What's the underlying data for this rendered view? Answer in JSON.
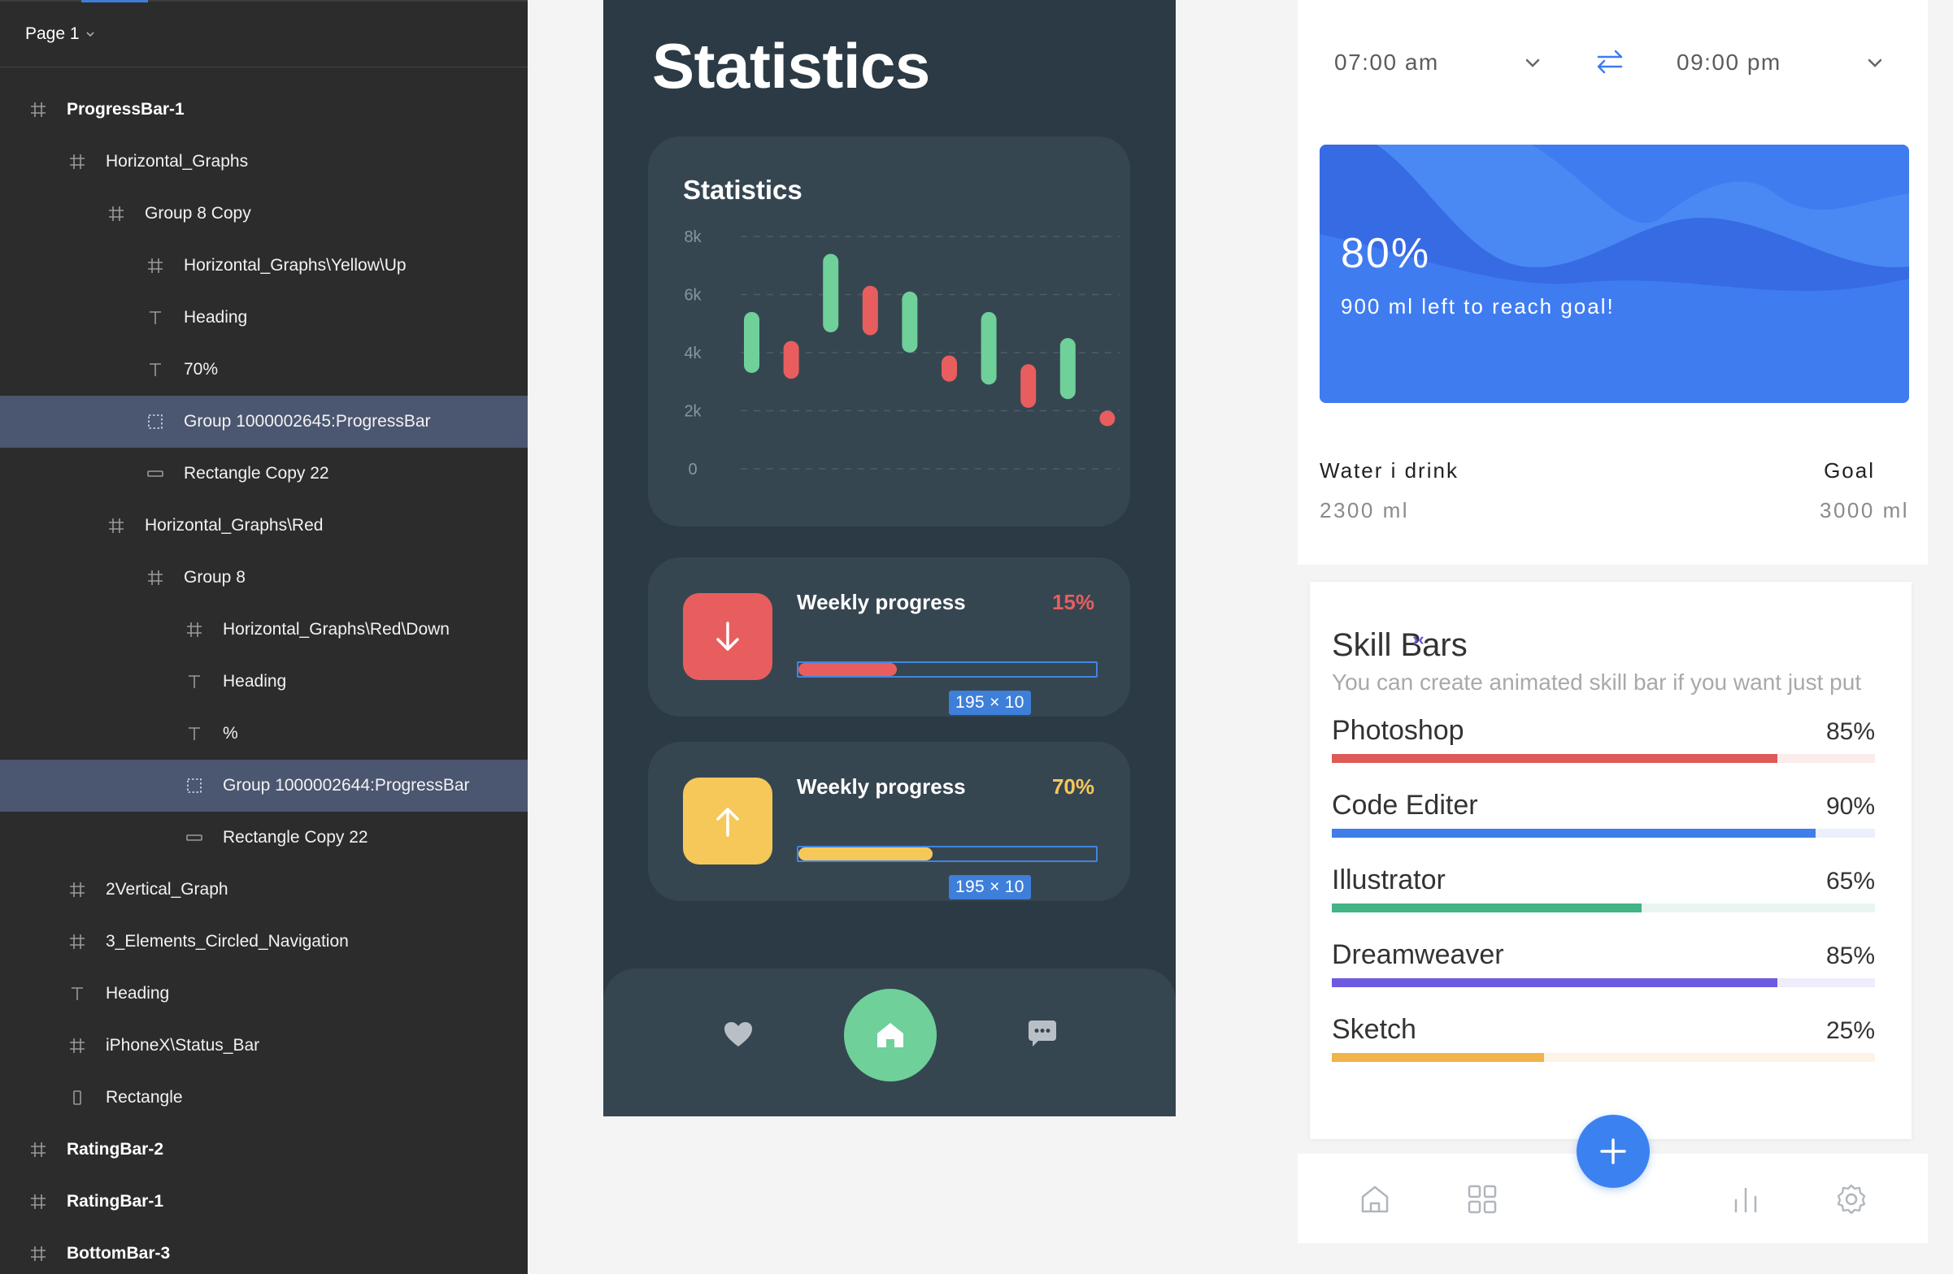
{
  "layers_panel": {
    "page_selector": "Page 1",
    "items": [
      {
        "label": "ProgressBar-1",
        "type": "frame",
        "level": 0,
        "bold": true,
        "selected": false
      },
      {
        "label": "Horizontal_Graphs",
        "type": "frame",
        "level": 1,
        "bold": false,
        "selected": false
      },
      {
        "label": "Group 8 Copy",
        "type": "frame",
        "level": 2,
        "bold": false,
        "selected": false
      },
      {
        "label": "Horizontal_Graphs\\Yellow\\Up",
        "type": "frame",
        "level": 3,
        "bold": false,
        "selected": false
      },
      {
        "label": "Heading",
        "type": "text",
        "level": 3,
        "bold": false,
        "selected": false
      },
      {
        "label": "70%",
        "type": "text",
        "level": 3,
        "bold": false,
        "selected": false
      },
      {
        "label": "Group 1000002645:ProgressBar",
        "type": "group",
        "level": 3,
        "bold": false,
        "selected": true
      },
      {
        "label": "Rectangle Copy 22",
        "type": "rect",
        "level": 3,
        "bold": false,
        "selected": false
      },
      {
        "label": "Horizontal_Graphs\\Red",
        "type": "frame",
        "level": 2,
        "bold": false,
        "selected": false
      },
      {
        "label": "Group 8",
        "type": "frame",
        "level": 3,
        "bold": false,
        "selected": false
      },
      {
        "label": "Horizontal_Graphs\\Red\\Down",
        "type": "frame",
        "level": 4,
        "bold": false,
        "selected": false
      },
      {
        "label": "Heading",
        "type": "text",
        "level": 4,
        "bold": false,
        "selected": false
      },
      {
        "label": "%",
        "type": "text",
        "level": 4,
        "bold": false,
        "selected": false
      },
      {
        "label": "Group 1000002644:ProgressBar",
        "type": "group",
        "level": 4,
        "bold": false,
        "selected": true
      },
      {
        "label": "Rectangle Copy 22",
        "type": "rect",
        "level": 4,
        "bold": false,
        "selected": false
      },
      {
        "label": "2Vertical_Graph",
        "type": "frame",
        "level": 1,
        "bold": false,
        "selected": false
      },
      {
        "label": "3_Elements_Circled_Navigation",
        "type": "frame",
        "level": 1,
        "bold": false,
        "selected": false
      },
      {
        "label": "Heading",
        "type": "text",
        "level": 1,
        "bold": false,
        "selected": false
      },
      {
        "label": "iPhoneX\\Status_Bar",
        "type": "frame",
        "level": 1,
        "bold": false,
        "selected": false
      },
      {
        "label": "Rectangle",
        "type": "rectv",
        "level": 1,
        "bold": false,
        "selected": false
      },
      {
        "label": "RatingBar-2",
        "type": "frame",
        "level": 0,
        "bold": true,
        "selected": false
      },
      {
        "label": "RatingBar-1",
        "type": "frame",
        "level": 0,
        "bold": true,
        "selected": false
      },
      {
        "label": "BottomBar-3",
        "type": "frame",
        "level": 0,
        "bold": true,
        "selected": false
      }
    ]
  },
  "stats_screen": {
    "title": "Statistics",
    "chart_card_title": "Statistics",
    "chart_data": {
      "type": "candlestick",
      "y_ticks": [
        "8k",
        "6k",
        "4k",
        "2k",
        "0"
      ],
      "ylim": [
        0,
        8000
      ],
      "grid": "dashed",
      "candles": [
        {
          "low": 3300,
          "high": 5400,
          "color": "#6fd09a"
        },
        {
          "low": 3100,
          "high": 4400,
          "color": "#e85e5e"
        },
        {
          "low": 4700,
          "high": 7400,
          "color": "#6fd09a"
        },
        {
          "low": 4600,
          "high": 6300,
          "color": "#e85e5e"
        },
        {
          "low": 4000,
          "high": 6100,
          "color": "#6fd09a"
        },
        {
          "low": 3000,
          "high": 3900,
          "color": "#e85e5e"
        },
        {
          "low": 2900,
          "high": 5400,
          "color": "#6fd09a"
        },
        {
          "low": 2100,
          "high": 3600,
          "color": "#e85e5e"
        },
        {
          "low": 2400,
          "high": 4500,
          "color": "#6fd09a"
        },
        {
          "low": 1600,
          "high": 2000,
          "color": "#e85e5e"
        }
      ]
    },
    "progress_cards": [
      {
        "label": "Weekly progress",
        "percent": "15%",
        "fill_fraction": 0.33,
        "color": "#e85e5e",
        "arrow": "down-arrow-icon",
        "dimension_tag": "195 × 10"
      },
      {
        "label": "Weekly progress",
        "percent": "70%",
        "fill_fraction": 0.45,
        "color": "#f6c85a",
        "arrow": "up-arrow-icon",
        "dimension_tag": "195 × 10"
      }
    ],
    "nav_icons": [
      "heart-icon",
      "home-icon",
      "chat-icon"
    ],
    "colors": {
      "bg": "#2b3a45",
      "card": "#364651",
      "accent_green": "#6fd09a",
      "red": "#e85e5e",
      "yellow": "#f6c85a"
    }
  },
  "water_screen": {
    "start_time": "07:00 am",
    "end_time": "09:00 pm",
    "percent": "80%",
    "left_text": "900 ml left to reach goal!",
    "water_label": "Water i drink",
    "water_value": "2300 ml",
    "goal_label": "Goal",
    "goal_value": "3000 ml",
    "wave_level": 0.8
  },
  "skill_bars": {
    "title": "Skill Bars",
    "subtitle": "You can create animated skill bar if you want just put",
    "skills": [
      {
        "name": "Photoshop",
        "percent": "85%",
        "level": 0.82,
        "color": "#de5a58",
        "track": "#fbeceb"
      },
      {
        "name": "Code Editer",
        "percent": "90%",
        "level": 0.89,
        "color": "#3f7ee8",
        "track": "#eaf1fc"
      },
      {
        "name": "Illustrator",
        "percent": "65%",
        "level": 0.57,
        "color": "#43b485",
        "track": "#e8f6ef"
      },
      {
        "name": "Dreamweaver",
        "percent": "85%",
        "level": 0.82,
        "color": "#6c5be0",
        "track": "#efedfb"
      },
      {
        "name": "Sketch",
        "percent": "25%",
        "level": 0.39,
        "color": "#f0b44a",
        "track": "#fdf3e6"
      }
    ],
    "bottom_icons": [
      "home-icon",
      "grid-icon",
      "plus-icon",
      "bar-chart-icon",
      "settings-icon"
    ]
  }
}
